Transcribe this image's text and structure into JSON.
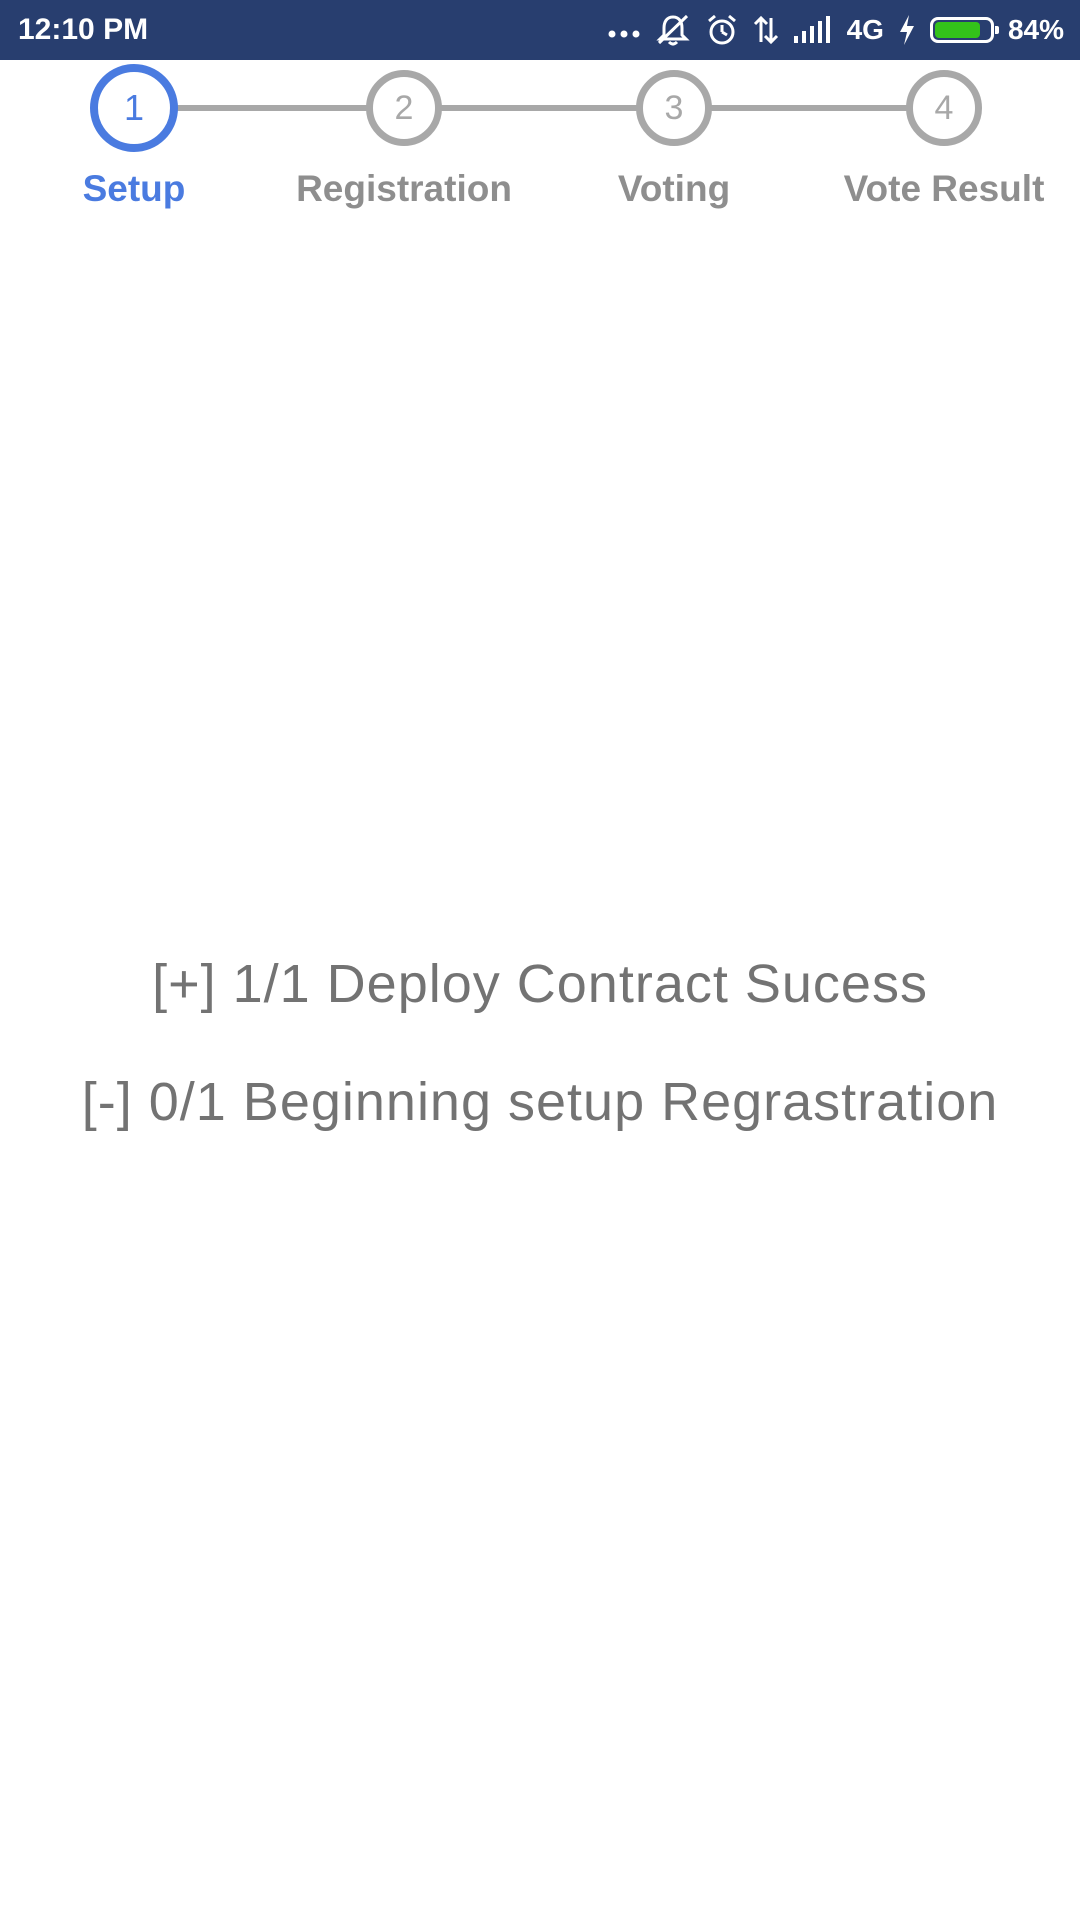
{
  "status_bar": {
    "time": "12:10 PM",
    "icons": [
      "more-dots-icon",
      "mute-icon",
      "alarm-icon",
      "data-transfer-icon",
      "signal-icon",
      "charging-icon",
      "battery-icon"
    ],
    "network": "4G",
    "battery_percent": "84%",
    "battery_level": 0.84,
    "background_color": "#283e6f"
  },
  "stepper": {
    "active_color": "#4a7be0",
    "inactive_color": "#a8a8a8",
    "steps": [
      {
        "number": "1",
        "label": "Setup",
        "active": true
      },
      {
        "number": "2",
        "label": "Registration",
        "active": false
      },
      {
        "number": "3",
        "label": "Voting",
        "active": false
      },
      {
        "number": "4",
        "label": "Vote Result",
        "active": false
      }
    ]
  },
  "log": {
    "lines": [
      "[+] 1/1 Deploy Contract Sucess",
      "[-] 0/1 Beginning setup Regrastration"
    ]
  }
}
